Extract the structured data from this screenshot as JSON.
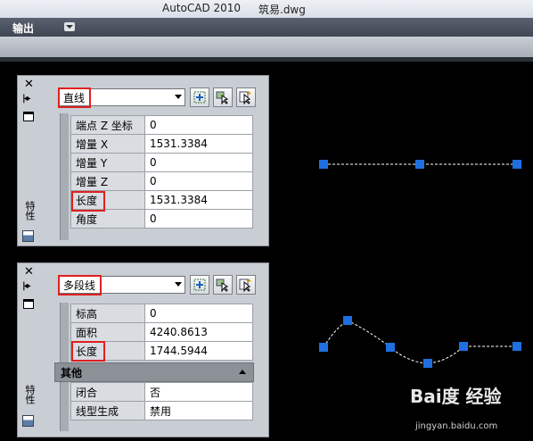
{
  "window": {
    "app_title": "AutoCAD 2010",
    "file_name": "筑易.dwg"
  },
  "menu": {
    "output_label": "输出"
  },
  "palette_line": {
    "side_label": "特性",
    "object_type": "直线",
    "properties": [
      {
        "label": "端点 Z 坐标",
        "value": "0"
      },
      {
        "label": "增量 X",
        "value": "1531.3384"
      },
      {
        "label": "增量 Y",
        "value": "0"
      },
      {
        "label": "增量 Z",
        "value": "0"
      },
      {
        "label": "长度",
        "value": "1531.3384"
      },
      {
        "label": "角度",
        "value": "0"
      }
    ]
  },
  "palette_polyline": {
    "side_label": "特性",
    "object_type": "多段线",
    "properties": [
      {
        "label": "标高",
        "value": "0"
      },
      {
        "label": "面积",
        "value": "4240.8613"
      },
      {
        "label": "长度",
        "value": "1744.5944"
      }
    ],
    "category": "其他",
    "misc": [
      {
        "label": "闭合",
        "value": "否"
      },
      {
        "label": "线型生成",
        "value": "禁用"
      }
    ]
  },
  "watermark": {
    "brand": "Bai度 经验",
    "url": "jingyan.baidu.com"
  },
  "colors": {
    "grip": "#1f6fe0",
    "highlight": "#e02020",
    "background": "#000000"
  },
  "icons": [
    "close-icon",
    "pin-icon",
    "menu-icon",
    "quick-select-icon",
    "select-objects-icon",
    "toggle-pickadd-icon"
  ]
}
